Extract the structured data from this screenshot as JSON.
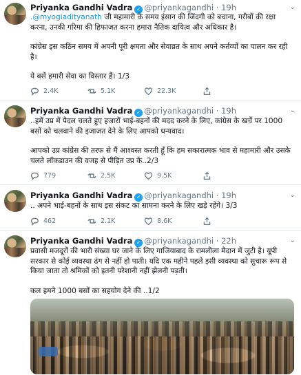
{
  "tweets": [
    {
      "name": "Priyanka Gandhi Vadra",
      "handle": "@priyankagandhi",
      "dot": "·",
      "time": "19h",
      "mention": ".@myogiadityanath",
      "p1_rest": " जी महामारी के समय इंसान की जिंदगी को बचाना, गरीबों की रक्षा करना, उनकी गरिमा की हिफाजत करना हमारा नैतिक दायित्व और अधिकार है।",
      "p2": "कांग्रेस इस कठिन समय में अपनी पूरी क्षमता और सेवाव्रत के साथ अपने कर्तव्यों का पालन कर रही है।",
      "p3": "ये बसें हमारी सेवा का विस्तार हैं। 1/3",
      "replies": "2.4K",
      "retweets": "5.1K",
      "likes": "22.3K"
    },
    {
      "name": "Priyanka Gandhi Vadra",
      "handle": "@priyankagandhi",
      "dot": "·",
      "time": "19h",
      "p1": "..हमें उप्र में पैदल चलते हुए हजारों भाई-बहनों की मदद करने के लिए, कांग्रेस के खर्चे पर 1000 बसों को चलवाने की इजाजत देने के लिए आपको धन्यवाद।",
      "p2": "आपको उप्र कांग्रेस की तरफ से मैं आश्वस्त करती हूँ कि हम सकारात्मक भाव से महामारी और उसके चलते लॉकडाउन की वजह से पीड़ित उप्र के..2/3",
      "replies": "779",
      "retweets": "2.5K",
      "likes": "9.5K"
    },
    {
      "name": "Priyanka Gandhi Vadra",
      "handle": "@priyankagandhi",
      "dot": "·",
      "time": "19h",
      "p1": ".. अपने भाई-बहनों के साथ इस संकट का सामना करने के लिए खड़े रहेंगे। 3/3",
      "replies": "462",
      "retweets": "2.1K",
      "likes": "8.6K"
    },
    {
      "name": "Priyanka Gandhi Vadra",
      "handle": "@priyankagandhi",
      "dot": "·",
      "time": "22h",
      "p1": "प्रवासी मजदूरों की भारी संख्या घर जाने के लिए गाजियाबाद के रामलीला मैदान में जुटी है। यूपी सरकार से कोई व्यवस्था ढंग से नहीं हो पाती। यदि एक महीने पहले इसी व्यवस्था को सुचारू रूप से किया जाता तो श्रमिकों को इतनी परेशानी नहीं झेलनी पड़ती।",
      "p2": "कल हमने 1000 बसों का सहयोग देने की ..1/2"
    }
  ],
  "icons": {
    "verified": "verified-badge-icon",
    "menu": "chevron-down-icon",
    "reply": "reply-icon",
    "retweet": "retweet-icon",
    "like": "like-icon",
    "share": "share-icon"
  },
  "colors": {
    "link": "#1b95e0",
    "verified": "#1da1f2",
    "secondary_text": "#657786",
    "divider": "#e6ecf0"
  }
}
